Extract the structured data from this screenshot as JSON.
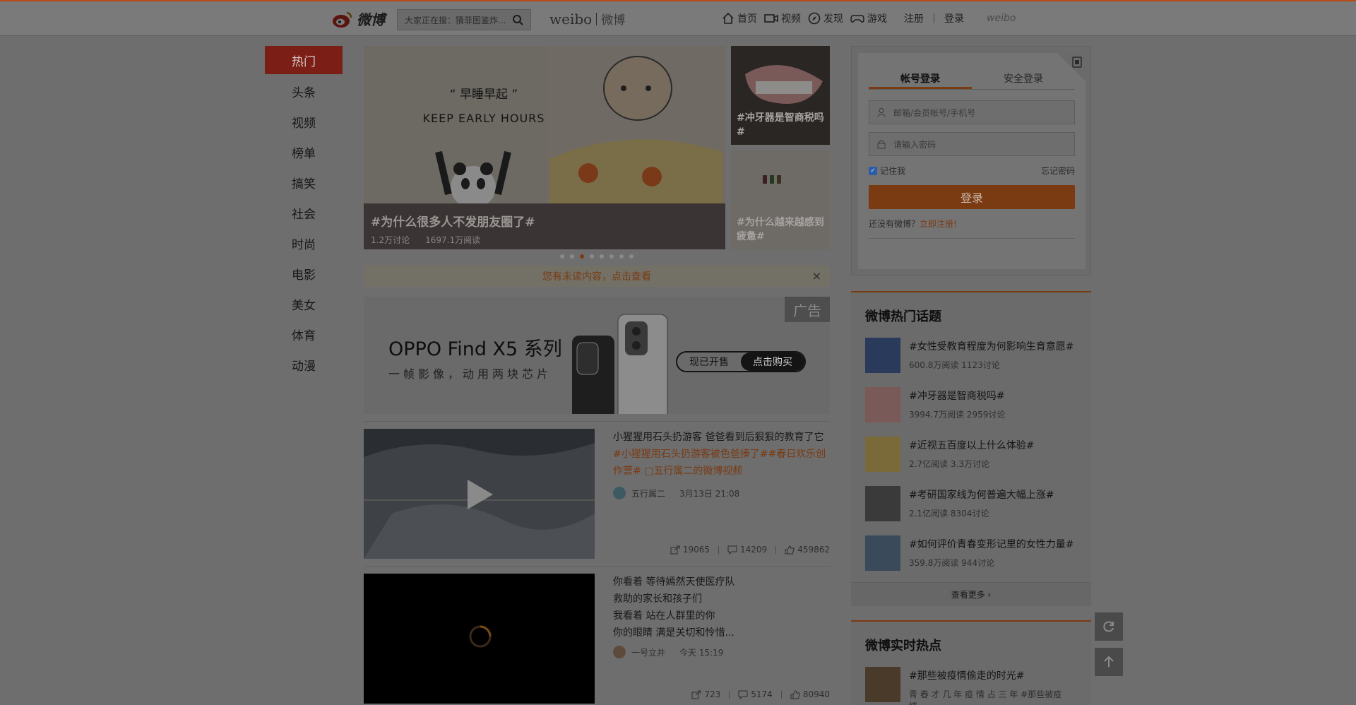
{
  "header": {
    "logo_text": "微博",
    "search_placeholder": "大家正在搜：猜菲图鉴炸...",
    "brand_latin": "weibo",
    "brand_cn": "微博",
    "nav": [
      {
        "label": "首页",
        "icon": "home-icon"
      },
      {
        "label": "视频",
        "icon": "video-icon"
      },
      {
        "label": "发现",
        "icon": "compass-icon"
      },
      {
        "label": "游戏",
        "icon": "gamepad-icon"
      }
    ],
    "register": "注册",
    "login": "登录",
    "weibo_mark": "weibo"
  },
  "leftnav": {
    "items": [
      "热门",
      "头条",
      "视频",
      "榜单",
      "搞笑",
      "社会",
      "时尚",
      "电影",
      "美女",
      "体育",
      "动漫"
    ],
    "active_index": 0
  },
  "carousel": {
    "main": {
      "title": "#为什么很多人不发朋友圈了#",
      "discussions": "1.2万讨论",
      "reads": "1697.1万阅读",
      "poster_line1": "“ 早睡早起 ”",
      "poster_line2": "KEEP EARLY HOURS"
    },
    "side": [
      {
        "title": "#冲牙器是智商税吗#"
      },
      {
        "title": "#为什么越来越感到疲惫#"
      }
    ],
    "dot_count": 8,
    "active_dot": 2
  },
  "notice": {
    "text": "您有未读内容，点击查看",
    "close": "×"
  },
  "ad": {
    "tag": "广告",
    "brand": "OPPO Find X5 系列",
    "slogan": "一帧影像，动用两块芯片",
    "cta_left": "现已开售",
    "cta_right": "点击购买"
  },
  "posts": [
    {
      "title": "小猩猩用石头扔游客 爸爸看到后狠狠的教育了它",
      "tags": "#小猩猩用石头扔游客被色爸揍了##春日欢乐创作营#",
      "video_tag": "五行属二的微博视频",
      "author": "五行属二",
      "time": "3月13日 21:08",
      "shares": "19065",
      "comments": "14209",
      "likes": "459862"
    },
    {
      "lines": [
        "你看着 等待嫣然天使医疗队",
        "救助的家长和孩子们",
        "我看着 站在人群里的你",
        "你的眼睛 满是关切和怜惜..."
      ],
      "author": "一号立井",
      "time": "今天 15:19",
      "shares": "723",
      "comments": "5174",
      "likes": "80940"
    }
  ],
  "login": {
    "tab_account": "帐号登录",
    "tab_secure": "安全登录",
    "username_placeholder": "邮箱/会员帐号/手机号",
    "password_placeholder": "请输入密码",
    "remember": "记住我",
    "forgot": "忘记密码",
    "submit": "登录",
    "no_account": "还没有微博？",
    "register_link": "立即注册!"
  },
  "hot_topics": {
    "title": "微博热门话题",
    "items": [
      {
        "title": "#女性受教育程度为何影响生育意愿#",
        "meta": "600.8万阅读 1123讨论"
      },
      {
        "title": "#冲牙器是智商税吗#",
        "meta": "3994.7万阅读 2959讨论"
      },
      {
        "title": "#近视五百度以上什么体验#",
        "meta": "2.7亿阅读 3.3万讨论"
      },
      {
        "title": "#考研国家线为何普遍大幅上涨#",
        "meta": "2.1亿阅读 8304讨论"
      },
      {
        "title": "#如何评价青春变形记里的女性力量#",
        "meta": "359.8万阅读 944讨论"
      }
    ],
    "more": "查看更多 ›"
  },
  "realtime": {
    "title": "微博实时热点",
    "items": [
      {
        "title": "#那些被疫情偷走的时光#",
        "meta": "青 春 才 几 年 疫 情 占 三 年 #那些被疫情..."
      }
    ]
  },
  "colors": {
    "accent": "#7a3a12",
    "overlay_bg": "#6e6e6e"
  }
}
